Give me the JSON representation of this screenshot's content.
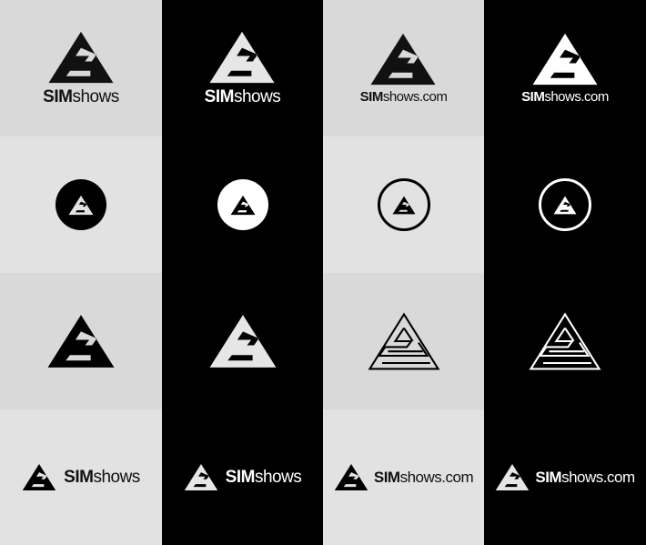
{
  "brand": {
    "name_bold": "SIM",
    "name_regular": "shows",
    "name_regular_com": "shows.com"
  },
  "colors": {
    "light_bg": "#d9d9d9",
    "dark_bg": "#000000",
    "ink_dark": "#111111",
    "ink_light": "#ffffff"
  },
  "icons": {
    "logo": "triangle-s-mark",
    "outline_logo": "triangle-s-outline-mark"
  }
}
